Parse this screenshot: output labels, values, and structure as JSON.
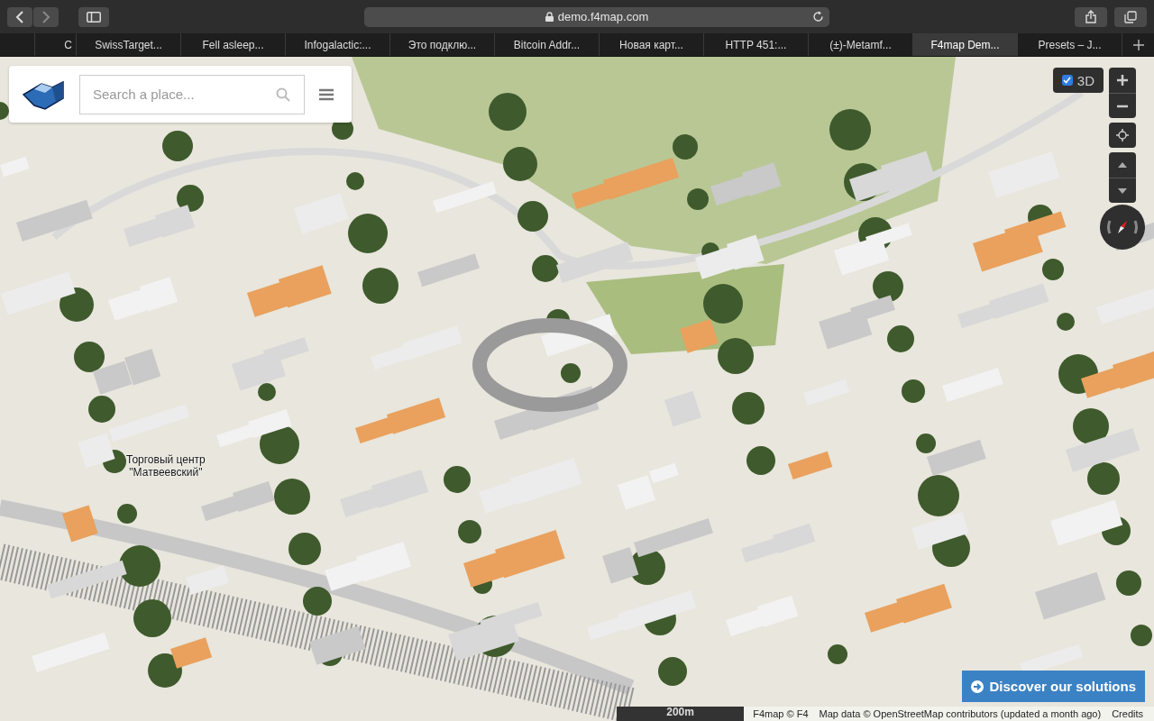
{
  "browser": {
    "address": "demo.f4map.com"
  },
  "tabs": [
    {
      "label": "C",
      "selected": false
    },
    {
      "label": "SwissTarget...",
      "selected": false
    },
    {
      "label": "Fell asleep...",
      "selected": false
    },
    {
      "label": "Infogalactic:...",
      "selected": false
    },
    {
      "label": "Это подклю...",
      "selected": false
    },
    {
      "label": "Bitcoin Addr...",
      "selected": false
    },
    {
      "label": "Новая карт...",
      "selected": false
    },
    {
      "label": "HTTP 451:...",
      "selected": false
    },
    {
      "label": "(±)-Metamf...",
      "selected": false
    },
    {
      "label": "F4map Dem...",
      "selected": true
    },
    {
      "label": "Presets – J...",
      "selected": false
    }
  ],
  "search": {
    "placeholder": "Search a place..."
  },
  "toggle_3d": {
    "label": "3D",
    "checked": true
  },
  "map": {
    "place_label": [
      "Торговый центр",
      "\"Матвеевский\""
    ]
  },
  "cta_button": "Discover our solutions",
  "scale": "200m",
  "attribution": [
    "F4map © F4",
    "Map data © OpenStreetMap contributors (updated a month ago)",
    "Credits"
  ]
}
